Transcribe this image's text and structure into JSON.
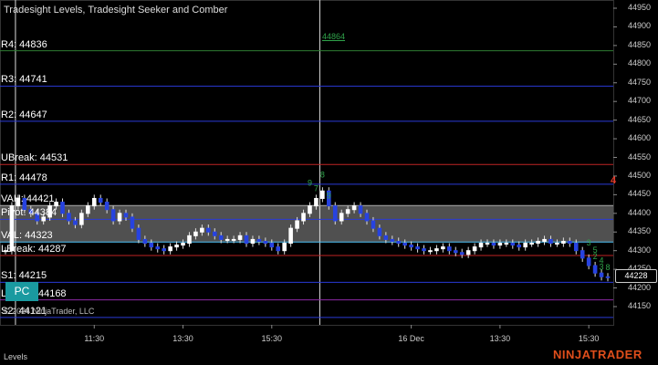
{
  "title": "Tradesight Levels, Tradesight Seeker and Comber",
  "levels": [
    {
      "label": "R4: 44836",
      "price": 44836,
      "color": "#2e7d32"
    },
    {
      "label": "R3: 44741",
      "price": 44741,
      "color": "#2a3ad6"
    },
    {
      "label": "R2: 44647",
      "price": 44647,
      "color": "#2a3ad6"
    },
    {
      "label": "UBreak: 44531",
      "price": 44531,
      "color": "#c02525"
    },
    {
      "label": "R1: 44478",
      "price": 44478,
      "color": "#2a3ad6"
    },
    {
      "label": "VAH: 44421",
      "price": 44421,
      "color": "#aaaaaa"
    },
    {
      "label": "Pivot: 44384",
      "price": 44384,
      "color": "#2a3ad6"
    },
    {
      "label": "VAL: 44323",
      "price": 44323,
      "color": "#4fc3f7"
    },
    {
      "label": "LBreak: 44287",
      "price": 44287,
      "color": "#c02525"
    },
    {
      "label": "S1: 44215",
      "price": 44215,
      "color": "#2a3ad6"
    },
    {
      "label": "LBreak: 44168",
      "price": 44168,
      "color": "#8e2aa6"
    },
    {
      "label": "S2: 44121",
      "price": 44121,
      "color": "#2a3ad6"
    }
  ],
  "value_area": {
    "high": 44421,
    "low": 44323
  },
  "r4_marker": "44864",
  "red_marker": "4",
  "pc_badge": "PC",
  "copyright": "© 2024 NinjaTrader, LLC",
  "tab": "Levels",
  "logo": "NINJATRADER",
  "current_price": "44228",
  "yaxis": {
    "min": 44130,
    "max": 44960,
    "ticks": [
      "44950",
      "44900",
      "44850",
      "44800",
      "44750",
      "44700",
      "44650",
      "44600",
      "44550",
      "44500",
      "44450",
      "44400",
      "44350",
      "44300",
      "44250",
      "44200",
      "44150"
    ]
  },
  "xaxis": [
    {
      "label": "11:30",
      "x_index": 14
    },
    {
      "label": "13:30",
      "x_index": 28
    },
    {
      "label": "15:30",
      "x_index": 42
    },
    {
      "label": "16 Dec",
      "x_index": 64
    },
    {
      "label": "13:30",
      "x_index": 78
    },
    {
      "label": "15:30",
      "x_index": 92
    }
  ],
  "session_breaks": [
    1,
    49
  ],
  "chart_data": {
    "type": "candlestick",
    "bar_count": 96,
    "closes": [
      44300,
      44420,
      44440,
      44410,
      44400,
      44380,
      44390,
      44420,
      44430,
      44400,
      44380,
      44370,
      44400,
      44420,
      44440,
      44430,
      44410,
      44380,
      44400,
      44390,
      44360,
      44330,
      44320,
      44310,
      44305,
      44300,
      44310,
      44315,
      44320,
      44340,
      44350,
      44360,
      44350,
      44340,
      44330,
      44330,
      44330,
      44340,
      44320,
      44330,
      44325,
      44320,
      44310,
      44300,
      44320,
      44360,
      44380,
      44400,
      44420,
      44440,
      44460,
      44420,
      44380,
      44400,
      44410,
      44420,
      44400,
      44380,
      44360,
      44340,
      44330,
      44325,
      44320,
      44315,
      44310,
      44305,
      44300,
      44300,
      44305,
      44310,
      44300,
      44295,
      44290,
      44300,
      44310,
      44320,
      44320,
      44315,
      44320,
      44320,
      44315,
      44310,
      44320,
      44320,
      44325,
      44330,
      44320,
      44320,
      44325,
      44320,
      44300,
      44280,
      44260,
      44240,
      44230,
      44228
    ],
    "annotations_green": [
      {
        "text": "7",
        "bar": 49
      },
      {
        "text": "8",
        "bar": 50
      },
      {
        "text": "9",
        "bar": 48
      },
      {
        "text": "9",
        "bar": 51
      },
      {
        "text": "2",
        "bar": 93
      },
      {
        "text": "3",
        "bar": 92
      },
      {
        "text": "3",
        "bar": 94
      },
      {
        "text": "4",
        "bar": 94
      },
      {
        "text": "5",
        "bar": 93
      },
      {
        "text": "8",
        "bar": 95
      }
    ]
  }
}
